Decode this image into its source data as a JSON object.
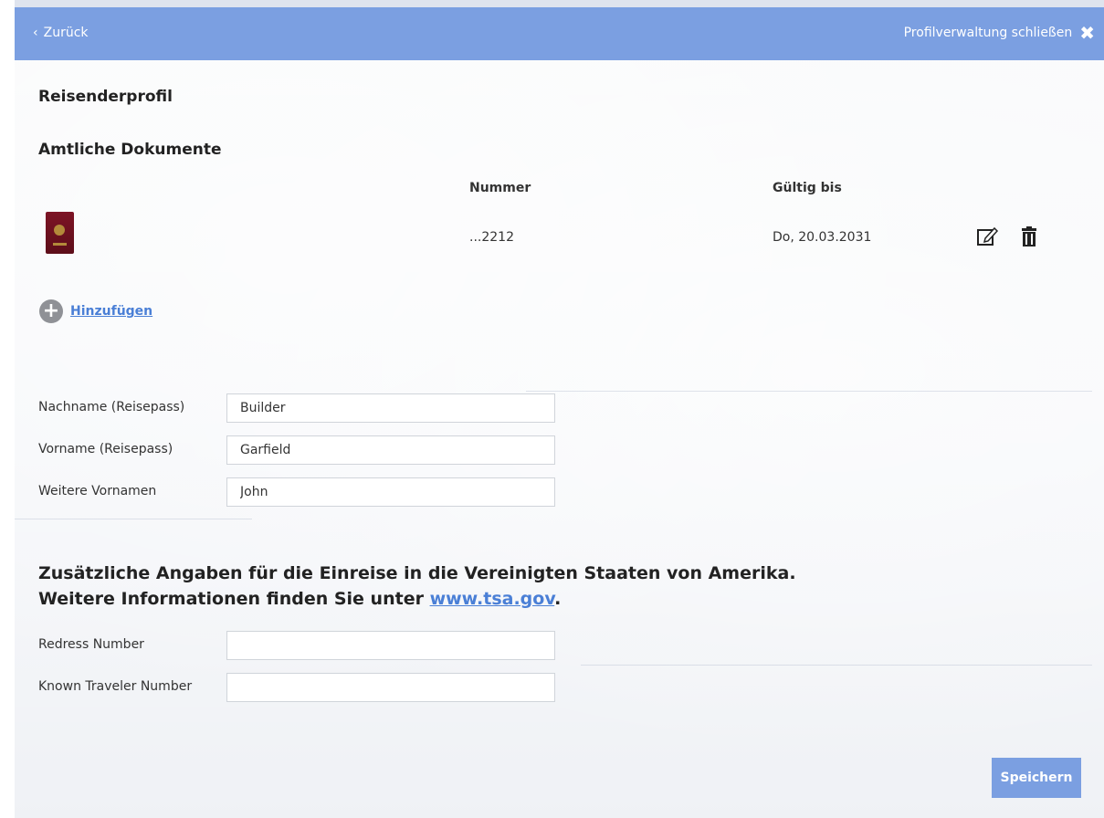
{
  "header": {
    "back_label": "Zurück",
    "close_label": "Profilverwaltung schließen"
  },
  "profile": {
    "title": "Reisenderprofil"
  },
  "documents": {
    "title": "Amtliche Dokumente",
    "columns": {
      "number": "Nummer",
      "valid_until": "Gültig bis"
    },
    "rows": [
      {
        "number": "...2212",
        "valid_until": "Do, 20.03.2031"
      }
    ],
    "add_label": "Hinzufügen"
  },
  "names": {
    "last_name_label": "Nachname (Reisepass)",
    "last_name_value": "Builder",
    "first_name_label": "Vorname (Reisepass)",
    "first_name_value": "Garfield",
    "middle_names_label": "Weitere Vornamen",
    "middle_names_value": "John"
  },
  "us_section": {
    "line1": "Zusätzliche Angaben für die Einreise in die Vereinigten Staaten von Amerika.",
    "line2_prefix": "Weitere Informationen finden Sie unter ",
    "link_text": "www.tsa.gov",
    "line2_suffix": ".",
    "redress_label": "Redress Number",
    "redress_value": "",
    "ktn_label": "Known Traveler Number",
    "ktn_value": ""
  },
  "save_label": "Speichern",
  "colors": {
    "accent": "#7b9fe1",
    "link": "#4a7fd6"
  },
  "icons": {
    "back": "chevron-left-icon",
    "close": "close-x-icon",
    "edit": "edit-pencil-icon",
    "delete": "trash-icon",
    "add": "plus-circle-icon",
    "passport": "passport-icon"
  }
}
